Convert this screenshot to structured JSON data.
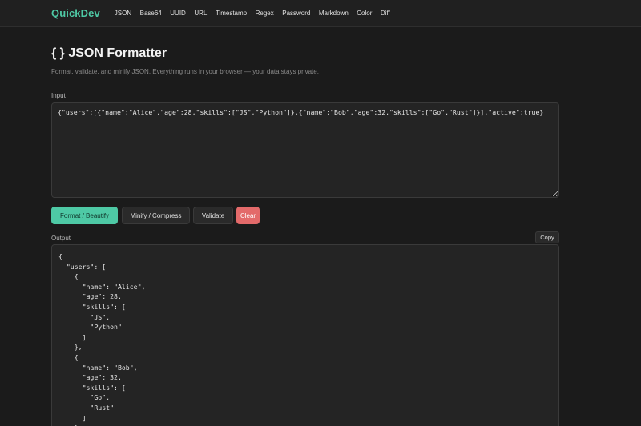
{
  "nav": {
    "brand": "QuickDev",
    "links": [
      "JSON",
      "Base64",
      "UUID",
      "URL",
      "Timestamp",
      "Regex",
      "Password",
      "Markdown",
      "Color",
      "Diff"
    ]
  },
  "page": {
    "title": "{ } JSON Formatter",
    "subtitle": "Format, validate, and minify JSON. Everything runs in your browser — your data stays private."
  },
  "input": {
    "label": "Input",
    "value": "{\"users\":[{\"name\":\"Alice\",\"age\":28,\"skills\":[\"JS\",\"Python\"]},{\"name\":\"Bob\",\"age\":32,\"skills\":[\"Go\",\"Rust\"]}],\"active\":true}"
  },
  "actions": {
    "format": "Format / Beautify",
    "minify": "Minify / Compress",
    "validate": "Validate",
    "clear": "Clear"
  },
  "output": {
    "label": "Output",
    "copy": "Copy",
    "text": "{\n  \"users\": [\n    {\n      \"name\": \"Alice\",\n      \"age\": 28,\n      \"skills\": [\n        \"JS\",\n        \"Python\"\n      ]\n    },\n    {\n      \"name\": \"Bob\",\n      \"age\": 32,\n      \"skills\": [\n        \"Go\",\n        \"Rust\"\n      ]\n    }"
  },
  "colors": {
    "accent": "#4ec9a5",
    "danger": "#e36a6a",
    "background": "#1b1b1b"
  }
}
